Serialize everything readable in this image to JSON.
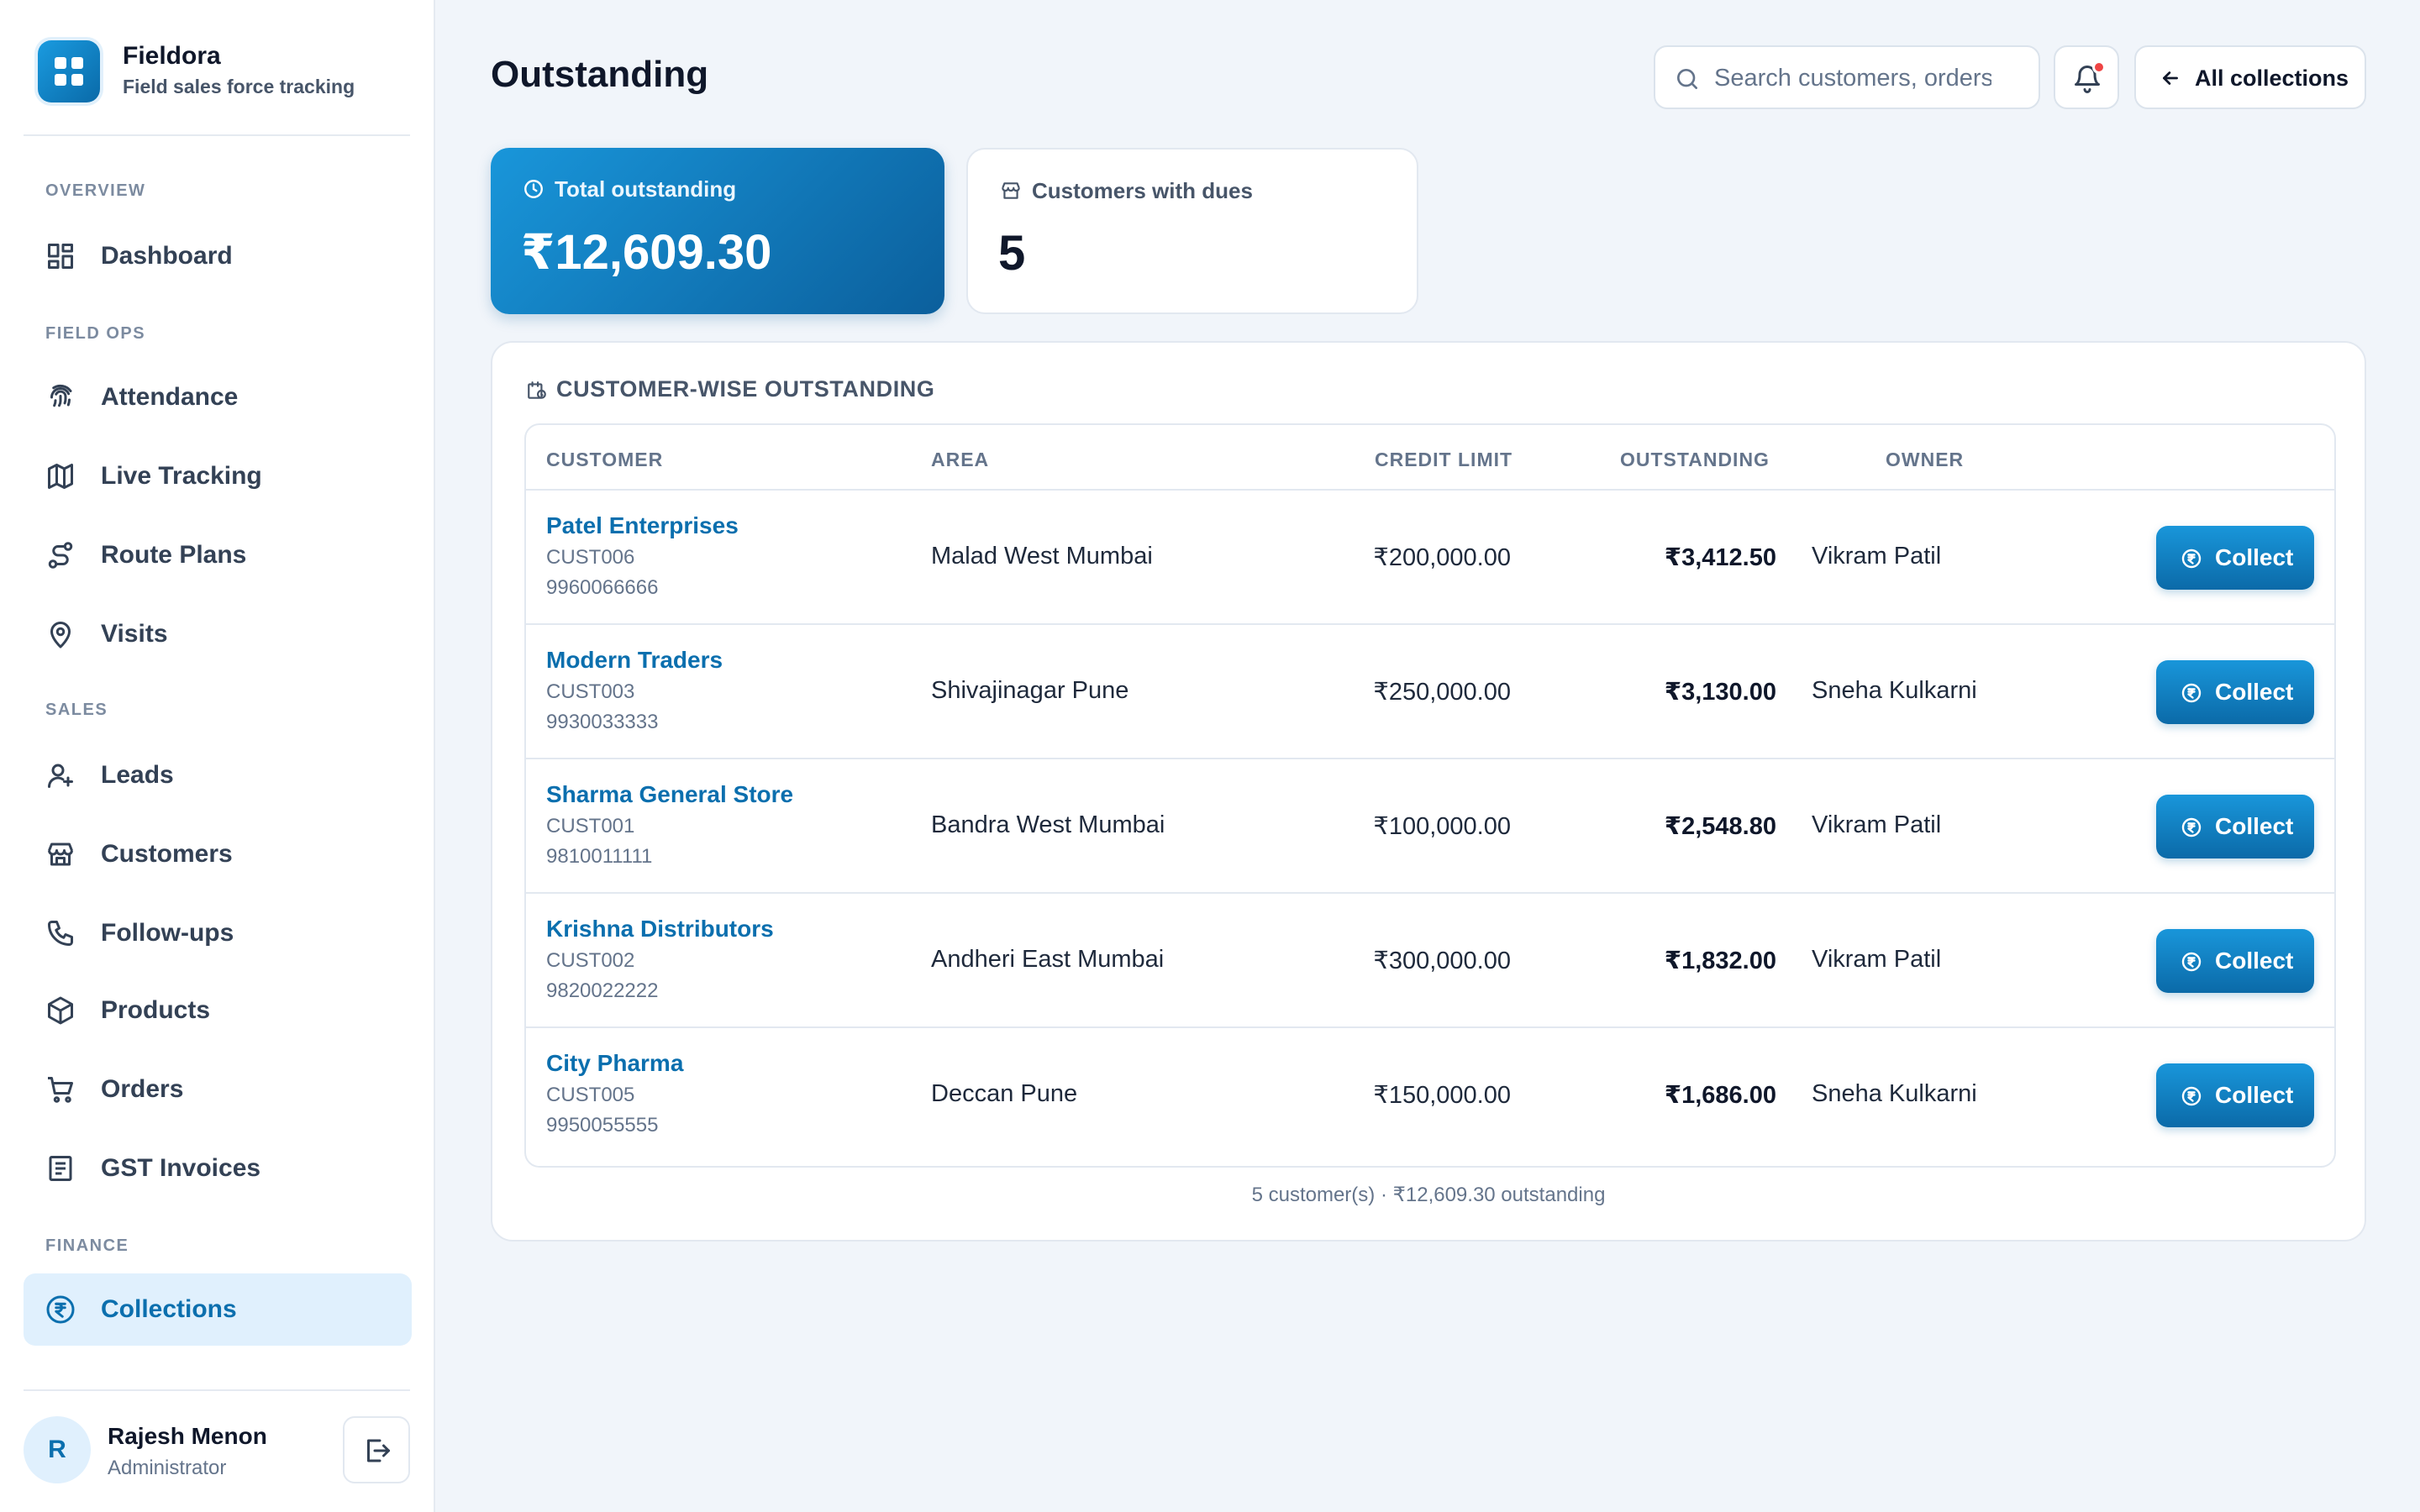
{
  "app": {
    "name": "Fieldora",
    "tagline": "Field sales force tracking"
  },
  "sidebar": {
    "sections": [
      {
        "title": "OVERVIEW"
      },
      {
        "title": "FIELD OPS"
      },
      {
        "title": "SALES"
      },
      {
        "title": "FINANCE"
      }
    ],
    "items": [
      {
        "label": "Dashboard",
        "icon": "dashboard-icon"
      },
      {
        "label": "Attendance",
        "icon": "fingerprint-icon"
      },
      {
        "label": "Live Tracking",
        "icon": "map-icon"
      },
      {
        "label": "Route Plans",
        "icon": "route-icon"
      },
      {
        "label": "Visits",
        "icon": "map-pin-icon"
      },
      {
        "label": "Leads",
        "icon": "user-plus-icon"
      },
      {
        "label": "Customers",
        "icon": "store-icon"
      },
      {
        "label": "Follow-ups",
        "icon": "phone-icon"
      },
      {
        "label": "Products",
        "icon": "box-icon"
      },
      {
        "label": "Orders",
        "icon": "cart-icon"
      },
      {
        "label": "GST Invoices",
        "icon": "receipt-icon"
      },
      {
        "label": "Collections",
        "icon": "rupee-circle-icon",
        "active": true
      }
    ]
  },
  "user": {
    "initial": "R",
    "name": "Rajesh Menon",
    "role": "Administrator"
  },
  "header": {
    "title": "Outstanding",
    "search_placeholder": "Search customers, orders",
    "back_label": "All collections"
  },
  "stats": {
    "total_label": "Total outstanding",
    "total_value": "₹12,609.30",
    "customers_label": "Customers with dues",
    "customers_value": "5"
  },
  "table": {
    "heading": "CUSTOMER-WISE OUTSTANDING",
    "columns": [
      "CUSTOMER",
      "AREA",
      "CREDIT LIMIT",
      "OUTSTANDING",
      "OWNER"
    ],
    "action_label": "Collect",
    "rows": [
      {
        "name": "Patel Enterprises",
        "code": "CUST006",
        "phone": "9960066666",
        "area": "Malad West Mumbai",
        "credit_limit": "₹200,000.00",
        "outstanding": "₹3,412.50",
        "owner": "Vikram Patil"
      },
      {
        "name": "Modern Traders",
        "code": "CUST003",
        "phone": "9930033333",
        "area": "Shivajinagar Pune",
        "credit_limit": "₹250,000.00",
        "outstanding": "₹3,130.00",
        "owner": "Sneha Kulkarni"
      },
      {
        "name": "Sharma General Store",
        "code": "CUST001",
        "phone": "9810011111",
        "area": "Bandra West Mumbai",
        "credit_limit": "₹100,000.00",
        "outstanding": "₹2,548.80",
        "owner": "Vikram Patil"
      },
      {
        "name": "Krishna Distributors",
        "code": "CUST002",
        "phone": "9820022222",
        "area": "Andheri East Mumbai",
        "credit_limit": "₹300,000.00",
        "outstanding": "₹1,832.00",
        "owner": "Vikram Patil"
      },
      {
        "name": "City Pharma",
        "code": "CUST005",
        "phone": "9950055555",
        "area": "Deccan Pune",
        "credit_limit": "₹150,000.00",
        "outstanding": "₹1,686.00",
        "owner": "Sneha Kulkarni"
      }
    ],
    "footer": "5 customer(s) · ₹12,609.30 outstanding"
  },
  "colors": {
    "accent": "#0b6fae",
    "accent_light": "#e0f0fd",
    "background": "#f1f5fa",
    "notification_dot": "#ef4444"
  }
}
